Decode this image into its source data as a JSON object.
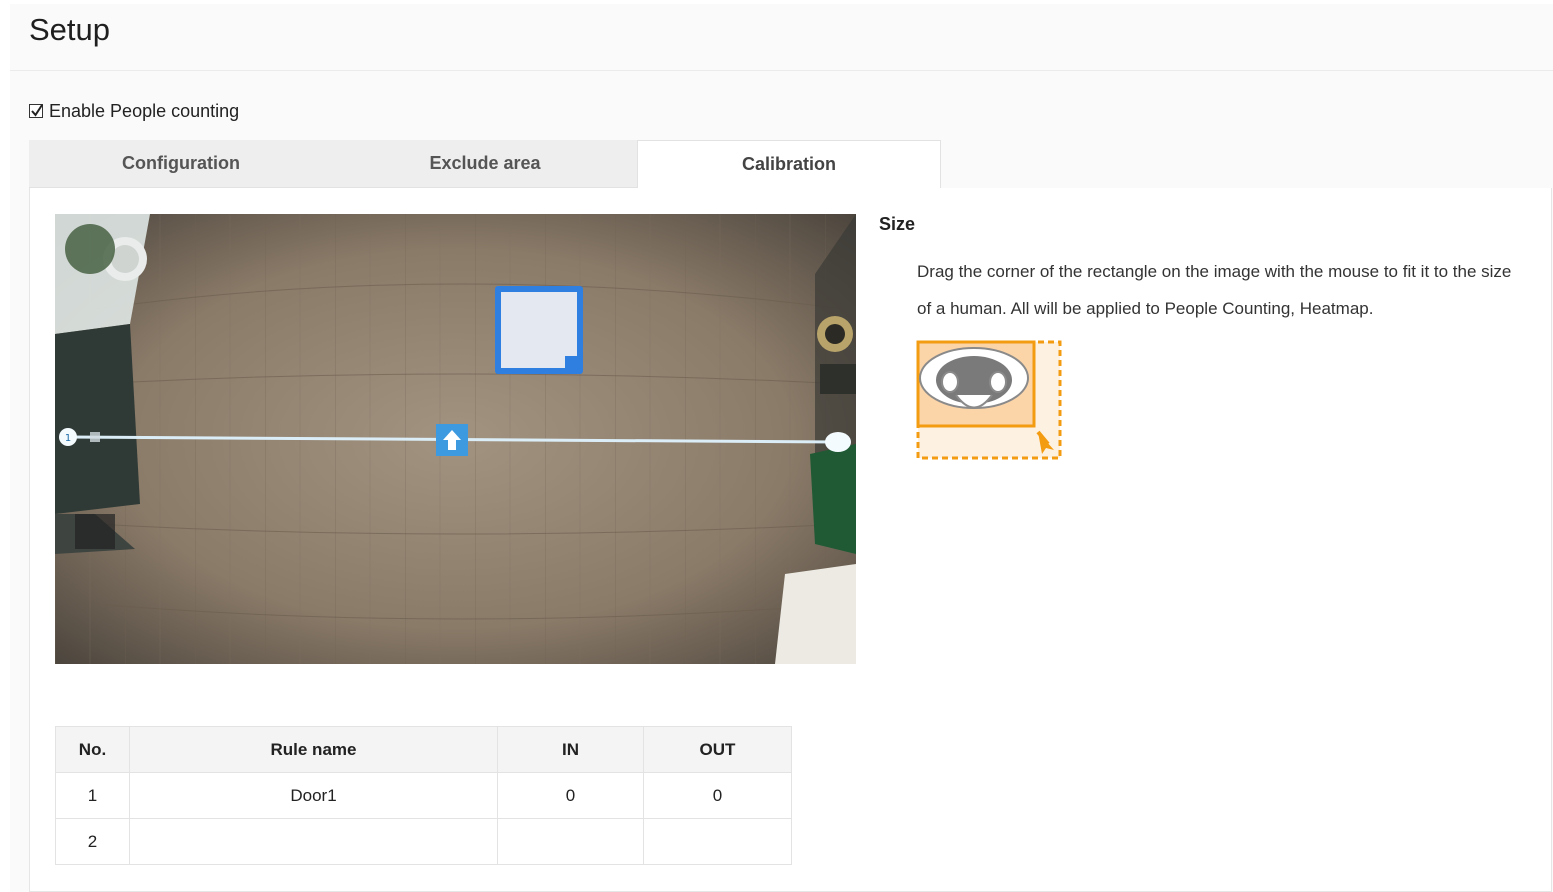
{
  "page": {
    "title": "Setup"
  },
  "enable": {
    "label": "Enable People counting",
    "checked": true
  },
  "tabs": [
    {
      "label": "Configuration",
      "active": false
    },
    {
      "label": "Exclude area",
      "active": false
    },
    {
      "label": "Calibration",
      "active": true
    }
  ],
  "camera": {
    "line_badge": "1"
  },
  "size_section": {
    "title": "Size",
    "description": "Drag the corner of the rectangle on the image with the mouse to fit it to the size of a human. All will be applied to People Counting, Heatmap."
  },
  "rules_table": {
    "headers": {
      "no": "No.",
      "name": "Rule name",
      "in": "IN",
      "out": "OUT"
    },
    "rows": [
      {
        "no": "1",
        "name": "Door1",
        "in": "0",
        "out": "0"
      },
      {
        "no": "2",
        "name": "",
        "in": "",
        "out": ""
      }
    ]
  },
  "colors": {
    "accent_blue": "#2f7fe0",
    "line_blue": "#4aa3df",
    "illustration_orange": "#f39c12"
  }
}
